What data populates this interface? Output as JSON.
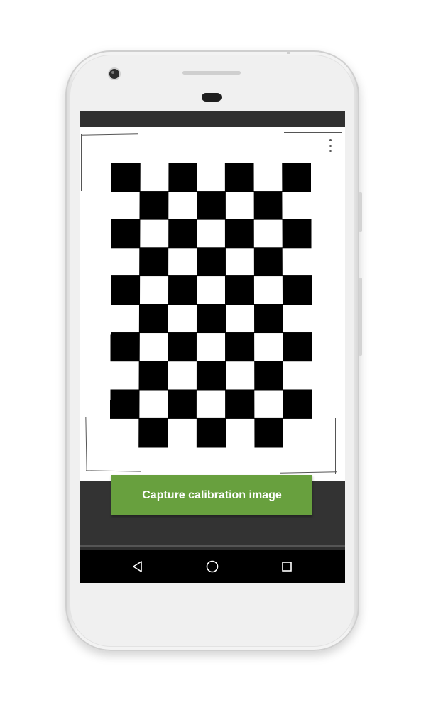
{
  "screen": {
    "capture_button_label": "Capture calibration image"
  },
  "icons": {
    "overflow_menu": "more-vert-icon",
    "nav_back": "back-triangle-icon",
    "nav_home": "home-circle-icon",
    "nav_recents": "recents-square-icon"
  },
  "colors": {
    "accent": "#68a03e",
    "status_bar": "#303030",
    "panel": "#333333",
    "nav_bar": "#000000"
  }
}
